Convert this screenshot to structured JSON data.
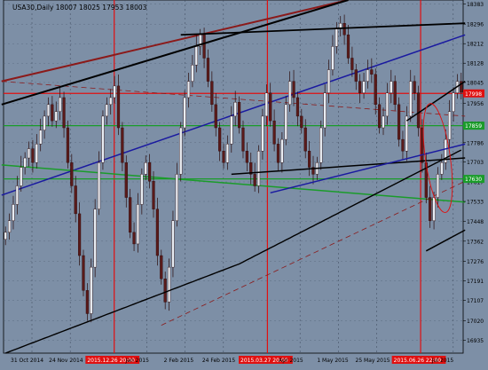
{
  "chart_data": {
    "type": "candlestick",
    "title": "USA30,Daily  18007 18025 17953 18003",
    "symbol": "USA30",
    "timeframe": "Daily",
    "ohlc_last": {
      "open": 18007,
      "high": 18025,
      "low": 17953,
      "close": 18003
    },
    "ylim": [
      16880,
      18400
    ],
    "y_ticks": [
      "18383",
      "18296",
      "18212",
      "18128",
      "18045",
      "17956",
      "17870",
      "17786",
      "17703",
      "17617",
      "17533",
      "17448",
      "17362",
      "17276",
      "17191",
      "17107",
      "17020",
      "16935"
    ],
    "y_highlight_labels": [
      {
        "label": "17998",
        "value": 17998
      },
      {
        "label": "17859",
        "value": 17859
      },
      {
        "label": "17630",
        "value": 17630
      }
    ],
    "x_ticks": [
      "31 Oct 2014",
      "24 Nov 2014",
      "2015.12.26 20:00",
      "Jan 2015",
      "2 Feb 2015",
      "24 Feb 2015",
      "2015.03.27 20:00",
      "Apr 2015",
      "1 May 2015",
      "25 May 2015",
      "2015.06.26 22:00",
      "Jul 2015"
    ],
    "x_highlight_ticks": [
      "2015.12.26 20:00",
      "2015.03.27 20:00",
      "2015.06.26 22:00"
    ],
    "grid": true,
    "colors": {
      "background": "#7d8fa6",
      "bull": "#e8ecf2",
      "bear": "#5a1a1a",
      "wick": "#2a0a0a",
      "axis_text": "#000000",
      "hline_red": "#e01010",
      "hline_green": "#1a9c2a",
      "trend_darkred": "#8b1a1a",
      "trend_blue": "#1a1aa0",
      "trend_black": "#000000",
      "trend_green": "#1a9c2a",
      "label_red": "#e01010",
      "label_green": "#1a9c2a"
    },
    "closes": [
      17400,
      17450,
      17520,
      17600,
      17680,
      17720,
      17760,
      17700,
      17780,
      17840,
      17900,
      17950,
      17880,
      17920,
      17980,
      17850,
      17700,
      17600,
      17480,
      17300,
      17150,
      17050,
      17250,
      17500,
      17700,
      17900,
      17950,
      17980,
      18030,
      17850,
      17700,
      17550,
      17400,
      17350,
      17520,
      17650,
      17700,
      17620,
      17500,
      17300,
      17200,
      17100,
      17250,
      17450,
      17650,
      17850,
      17980,
      18050,
      18120,
      18200,
      18250,
      18150,
      18050,
      17950,
      17850,
      17750,
      17700,
      17780,
      17900,
      17960,
      17850,
      17750,
      17700,
      17650,
      17600,
      17750,
      17900,
      18000,
      17880,
      17780,
      17700,
      17800,
      17950,
      18050,
      17980,
      17900,
      17850,
      17750,
      17680,
      17650,
      17700,
      17850,
      18000,
      18100,
      18200,
      18280,
      18300,
      18250,
      18150,
      18100,
      18050,
      18000,
      18050,
      18100,
      18080,
      17950,
      17850,
      17900,
      18000,
      18050,
      17950,
      17800,
      17750,
      17900,
      18050,
      18000,
      17850,
      17700,
      17550,
      17450,
      17550,
      17650,
      17700,
      17800,
      17920,
      18000,
      18050,
      18003
    ]
  }
}
